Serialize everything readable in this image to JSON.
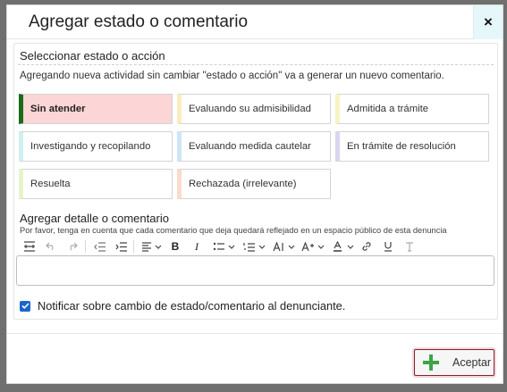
{
  "modal": {
    "title": "Agregar estado o comentario",
    "close_label": "×"
  },
  "status_section": {
    "title": "Seleccionar estado o acción",
    "description": "Agregando nueva actividad sin cambiar \"estado o acción\" va a generar un nuevo comentario.",
    "options": [
      {
        "label": "Sin atender",
        "color": "#1a6b1a",
        "selected": true
      },
      {
        "label": "Evaluando su admisibilidad",
        "color": "#fbecc0",
        "selected": false
      },
      {
        "label": "Admitida a trámite",
        "color": "#f7f3c4",
        "selected": false
      },
      {
        "label": "Investigando y recopilando",
        "color": "#cfeff1",
        "selected": false
      },
      {
        "label": "Evaluando medida cautelar",
        "color": "#cde6f6",
        "selected": false
      },
      {
        "label": "En trámite de resolución",
        "color": "#dcd5f1",
        "selected": false
      },
      {
        "label": "Resuelta",
        "color": "#e6f4cc",
        "selected": false
      },
      {
        "label": "Rechazada (irrelevante)",
        "color": "#f9dccb",
        "selected": false
      }
    ]
  },
  "detail": {
    "title": "Agregar detalle o comentario",
    "hint": "Por favor, tenga en cuenta que cada comentario que deja quedará reflejado en un espacio público de esta denuncia",
    "editor_value": ""
  },
  "toolbar_icons": [
    "page-break-icon",
    "undo-icon",
    "redo-icon",
    "outdent-icon",
    "indent-icon",
    "align-left-icon",
    "bold-icon",
    "italic-icon",
    "bulleted-list-icon",
    "numbered-list-icon",
    "font-size-icon",
    "font-family-icon",
    "font-color-icon",
    "link-icon",
    "underline-icon",
    "remove-format-icon"
  ],
  "notify": {
    "label": "Notificar sobre cambio de estado/comentario al denunciante.",
    "checked": true
  },
  "footer": {
    "accept_label": "Aceptar",
    "accent_color": "#8a1f2c"
  }
}
